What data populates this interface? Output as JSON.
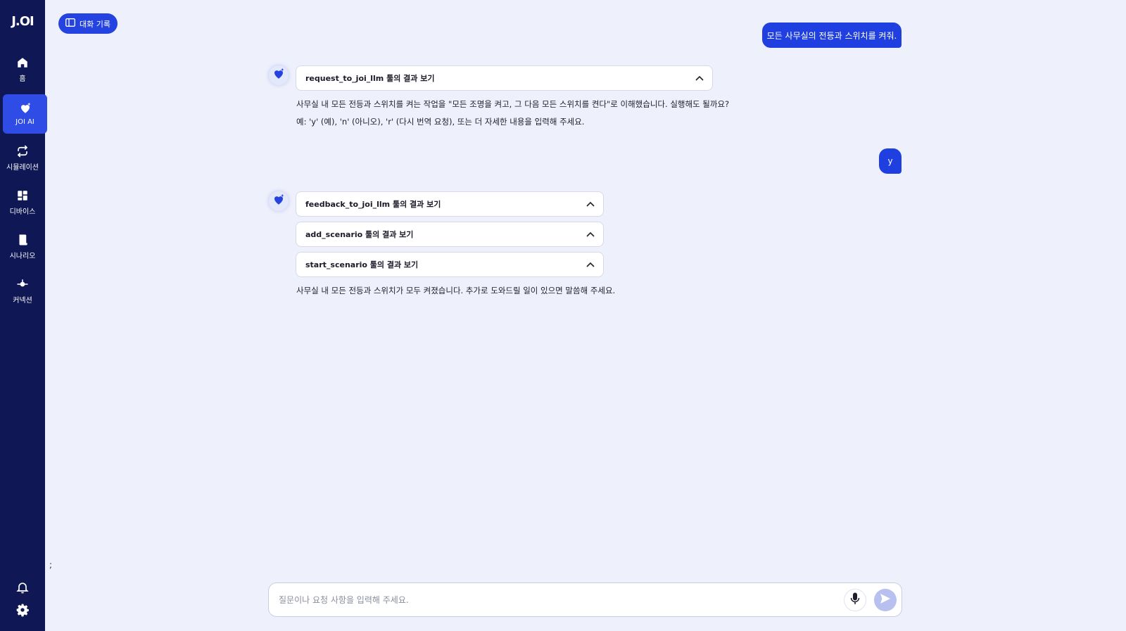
{
  "app": {
    "logo": "J.OI"
  },
  "sidebar": {
    "items": [
      {
        "label": "홈",
        "icon": "home-icon"
      },
      {
        "label": "JOI AI",
        "icon": "ai-heart-icon",
        "active": true
      },
      {
        "label": "시뮬레이션",
        "icon": "repeat-icon"
      },
      {
        "label": "디바이스",
        "icon": "dashboard-icon"
      },
      {
        "label": "시나리오",
        "icon": "scroll-icon"
      },
      {
        "label": "커넥션",
        "icon": "connection-icon"
      }
    ],
    "bottom": [
      "bell-icon",
      "gear-icon"
    ]
  },
  "header": {
    "history_button": "대화 기록"
  },
  "chat": {
    "messages": [
      {
        "role": "user",
        "text": "모든 사무실의 전등과 스위치를 켜줘."
      },
      {
        "role": "assistant",
        "tools": [
          "request_to_joi_llm 툴의 결과 보기"
        ],
        "lines": [
          "사무실 내 모든 전등과 스위치를 켜는 작업을 \"모든 조명을 켜고, 그 다음 모든 스위치를 켠다\"로 이해했습니다. 실행해도 될까요?",
          "예: 'y' (예), 'n' (아니오), 'r' (다시 번역 요청), 또는 더 자세한 내용을 입력해 주세요."
        ]
      },
      {
        "role": "user",
        "text": "y"
      },
      {
        "role": "assistant",
        "tools": [
          "feedback_to_joi_llm 툴의 결과 보기",
          "add_scenario 툴의 결과 보기",
          "start_scenario 툴의 결과 보기"
        ],
        "lines": [
          "사무실 내 모든 전등과 스위치가 모두 켜졌습니다. 추가로 도와드릴 일이 있으면 말씀해 주세요."
        ]
      }
    ]
  },
  "stray_char": ";",
  "composer": {
    "placeholder": "질문이나 요청 사항을 입력해 주세요."
  },
  "colors": {
    "sidebar": "#0f1754",
    "accent": "#2543e0",
    "background": "#eef0fb"
  }
}
